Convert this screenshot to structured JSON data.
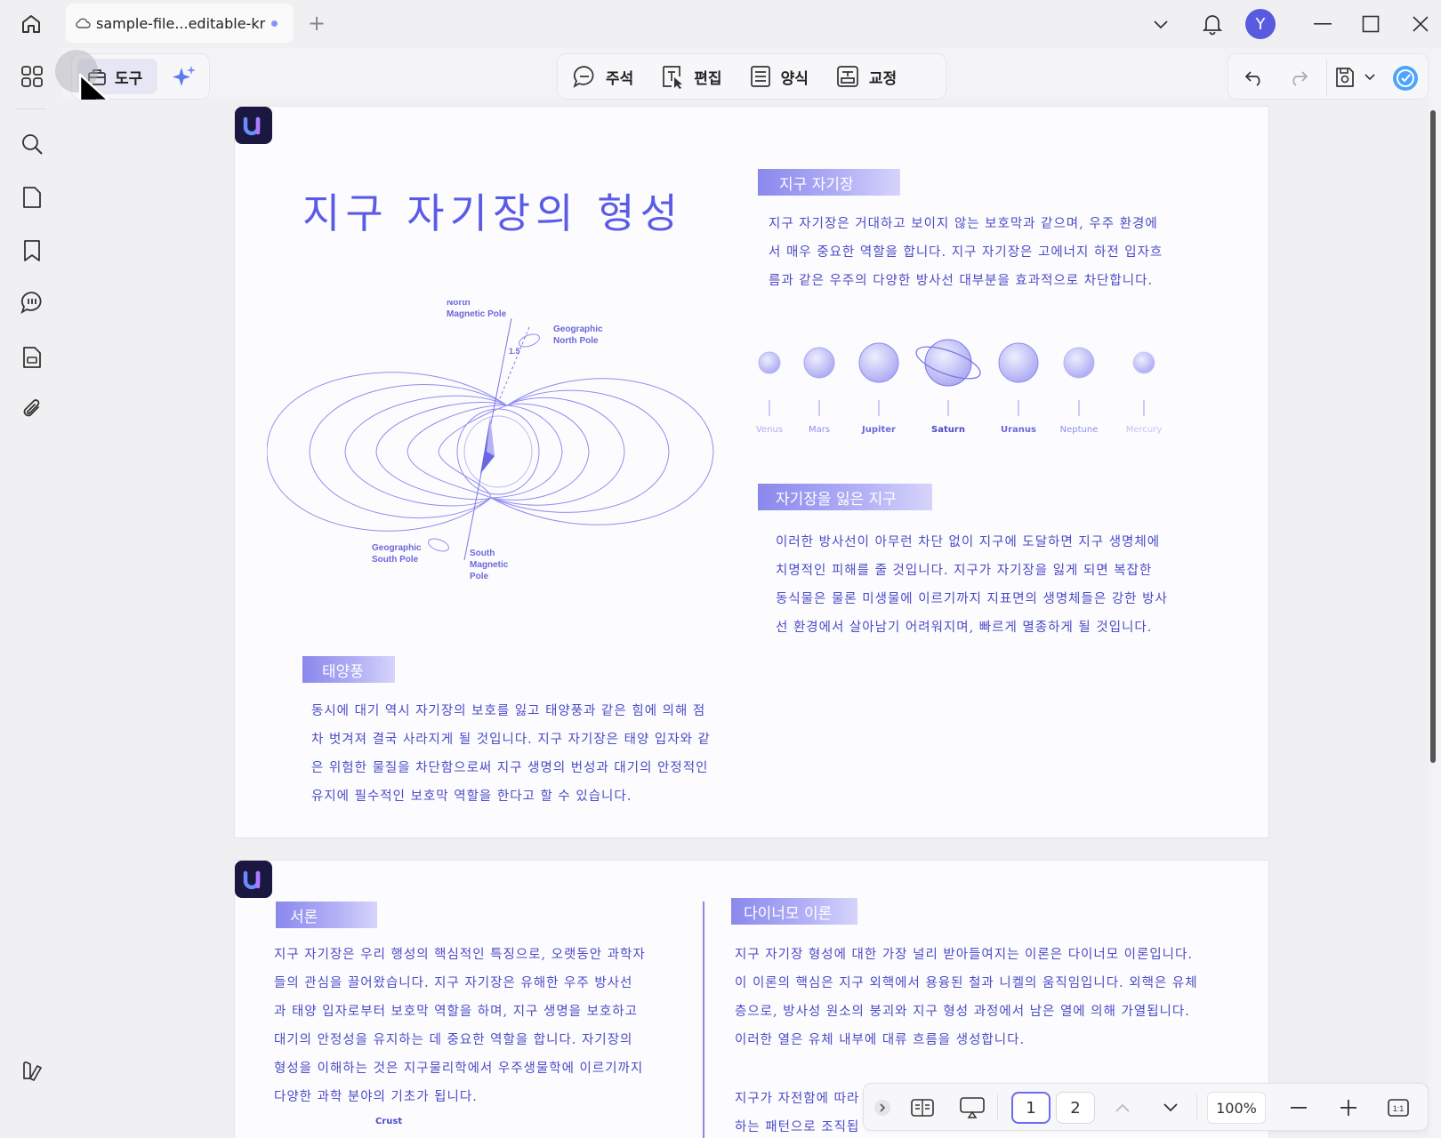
{
  "titlebar": {
    "tab_title": "sample-file...editable-kr",
    "avatar_letter": "Y"
  },
  "toolbar": {
    "tools_label": "도구",
    "modes": [
      {
        "label": "주석",
        "icon": "comment-icon"
      },
      {
        "label": "편집",
        "icon": "edit-text-icon"
      },
      {
        "label": "양식",
        "icon": "form-icon"
      },
      {
        "label": "교정",
        "icon": "redact-icon"
      }
    ]
  },
  "page1": {
    "title": "지구 자기장의 형성",
    "section_earth_field": {
      "heading": "지구 자기장",
      "lines": [
        "지구 자기장은 거대하고 보이지 않는 보호막과 같으며, 우주 환경에",
        "서 매우 중요한 역할을 합니다. 지구 자기장은 고에너지 하전 입자흐",
        "름과 같은 우주의 다양한 방사선 대부분을 효과적으로 차단합니다."
      ]
    },
    "planets": [
      "Venus",
      "Mars",
      "Jupiter",
      "Saturn",
      "Uranus",
      "Neptune",
      "Mercury"
    ],
    "section_lost": {
      "heading": "자기장을 잃은 지구",
      "lines": [
        "이러한 방사선이 아무런 차단 없이 지구에 도달하면 지구 생명체에",
        "치명적인 피해를 줄 것입니다. 지구가 자기장을 잃게 되면 복잡한",
        "동식물은 물론 미생물에 이르기까지 지표면의 생명체들은 강한 방사",
        "선 환경에서 살아남기 어려워지며, 빠르게 멸종하게 될 것입니다."
      ]
    },
    "section_solar_wind": {
      "heading": "태양풍",
      "lines": [
        "동시에 대기 역시 자기장의 보호를 잃고 태양풍과 같은 힘에 의해 점",
        "차 벗겨져 결국 사라지게 될 것입니다. 지구 자기장은 태양 입자와 같",
        "은 위험한 물질을 차단함으로써 지구 생명의 번성과 대기의 안정적인",
        "유지에 필수적인 보호막 역할을 한다고 할 수 있습니다."
      ]
    },
    "diagram_labels": {
      "north_magnetic": "North Magnetic Pole",
      "north_magnetic_l1": "North",
      "north_magnetic_l2": "Magnetic Pole",
      "geo_north_l1": "Geographic",
      "geo_north_l2": "North Pole",
      "angle": "1.5",
      "geo_south_l1": "Geographic",
      "geo_south_l2": "South Pole",
      "south_mag_l1": "South",
      "south_mag_l2": "Magnetic",
      "south_mag_l3": "Pole"
    }
  },
  "page2": {
    "section_intro": {
      "heading": "서론",
      "lines": [
        "지구 자기장은 우리 행성의 핵심적인 특징으로, 오랫동안 과학자",
        "들의 관심을 끌어왔습니다. 지구 자기장은 유해한 우주 방사선",
        "과 태양 입자로부터 보호막 역할을 하며, 지구 생명을 보호하고",
        "대기의 안정성을 유지하는 데 중요한 역할을 합니다. 자기장의",
        "형성을 이해하는 것은 지구물리학에서 우주생물학에 이르기까지",
        "다양한 과학 분야의 기초가 됩니다."
      ],
      "crust_label": "Crust"
    },
    "section_dynamo": {
      "heading": "다이너모 이론",
      "lines": [
        "지구 자기장 형성에 대한 가장 널리 받아들여지는 이론은 다이너모 이론입니다.",
        "이 이론의 핵심은 지구 외핵에서 용융된 철과 니켈의 움직임입니다. 외핵은 유체",
        "층으로, 방사성 원소의 붕괴와 지구 형성 과정에서 남은 열에 의해 가열됩니다.",
        "이러한 열은 유체 내부에 대류 흐름을 생성합니다."
      ],
      "line5_start": "지구가 자전함에 따라",
      "line6_start": "하는 패턴으로 조직됩"
    }
  },
  "nav": {
    "pages": [
      "1",
      "2"
    ],
    "current_page": "1",
    "zoom": "100%"
  },
  "colors": {
    "accent": "#5b5be8",
    "text_blue": "#4b4bc8",
    "tag": "#8a88ec"
  }
}
